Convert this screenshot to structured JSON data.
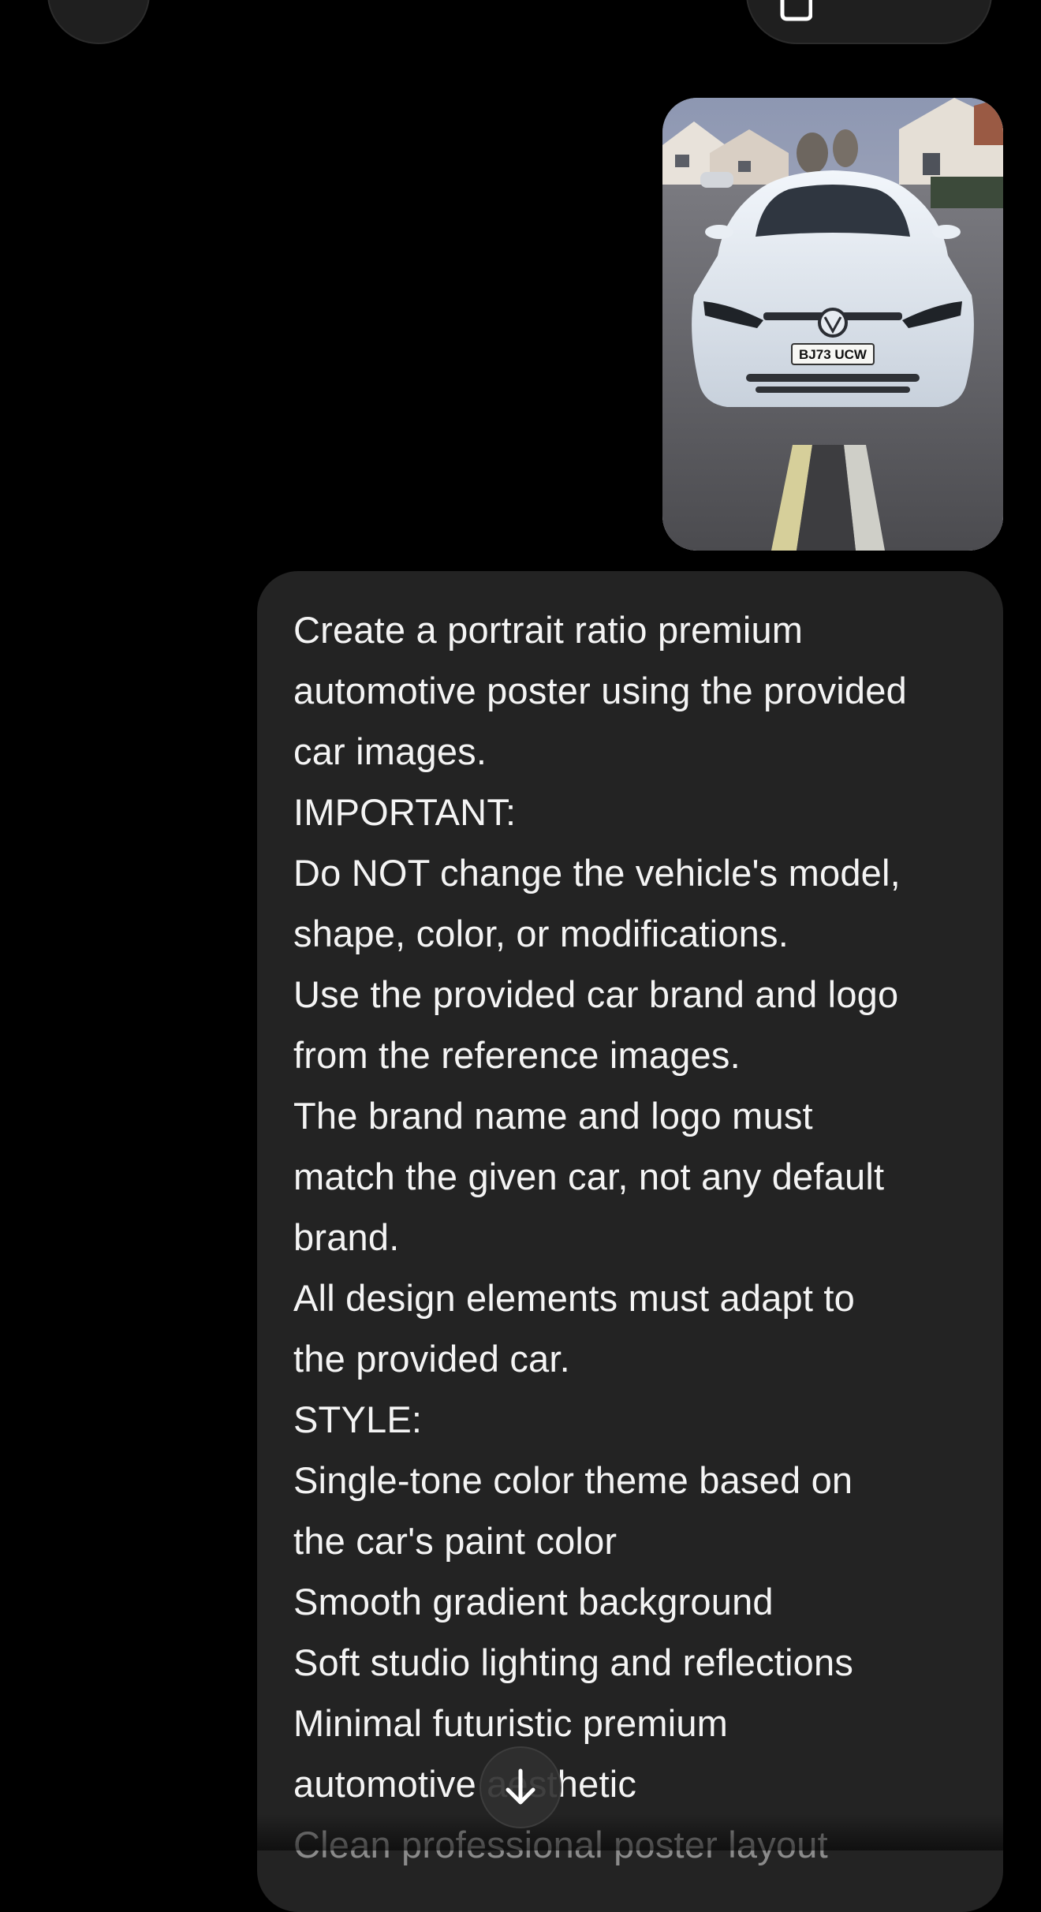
{
  "header": {
    "menu_icon": "menu-icon",
    "pill_icon": "new-chat-icon"
  },
  "attachment": {
    "plate_text": "BJ73 UCW"
  },
  "message": {
    "lines": [
      "Create a portrait ratio premium",
      "automotive poster using the provided",
      "car images.",
      "IMPORTANT:",
      "Do NOT change the vehicle's model,",
      "shape, color, or modifications.",
      "Use the provided car brand and logo",
      "from the reference images.",
      "The brand name and logo must",
      "match the given car, not any default",
      "brand.",
      "All design elements must adapt to",
      "the provided car.",
      "STYLE:",
      "Single-tone color theme based on",
      "the car's paint color",
      "Smooth gradient background",
      "Soft studio lighting and reflections",
      "Minimal futuristic premium",
      "automotive aesthetic",
      "Clean professional poster layout"
    ]
  },
  "scroll_button": {
    "icon": "arrow-down-icon"
  },
  "colors": {
    "background": "#000000",
    "bubble": "#232323",
    "text": "#f4f4f4"
  }
}
